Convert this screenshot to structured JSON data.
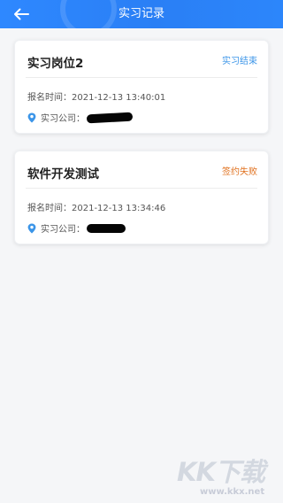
{
  "header": {
    "title": "实习记录",
    "back_icon": "arrow-left-icon",
    "background_color": "#2c84fb"
  },
  "records": [
    {
      "title": "实习岗位2",
      "status": "实习结束",
      "status_color": "#3b95e8",
      "time_label": "报名时间：",
      "time_value": "2021-12-13 13:40:01",
      "company_label": "实习公司：",
      "company_icon": "location-pin-icon"
    },
    {
      "title": "软件开发测试",
      "status": "签约失败",
      "status_color": "#e0701d",
      "time_label": "报名时间：",
      "time_value": "2021-12-13 13:34:46",
      "company_label": "实习公司：",
      "company_icon": "location-pin-icon"
    }
  ],
  "watermark": {
    "logo_text": "KK下载",
    "url": "www.kkx.net"
  }
}
